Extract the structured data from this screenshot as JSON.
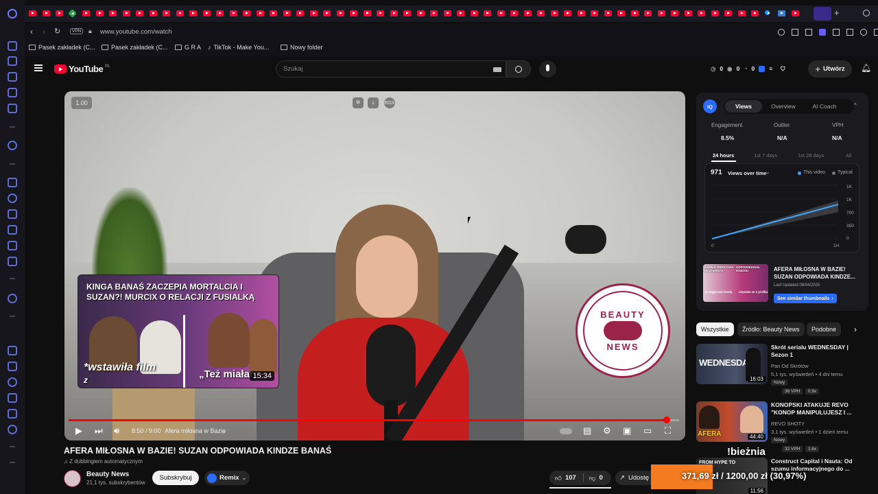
{
  "browser": {
    "url": "www.youtube.com/watch",
    "vpn_label": "VPN",
    "bookmarks": [
      "Pasek zakładek (C...",
      "Pasek zakładek (C...",
      "G R A",
      "TikTok - Make You...",
      "Nowy folder"
    ]
  },
  "header": {
    "logo": "YouTube",
    "logo_region": "PL",
    "search_placeholder": "Szukaj",
    "stats": [
      "0",
      "0",
      "0"
    ],
    "create_label": "Utwórz"
  },
  "player": {
    "speed": "1.00",
    "top_badge": "RGX",
    "current_time": "8:50 / 9:00",
    "chapter": "Afera miłosna w Bazie",
    "progress_fraction": 0.98,
    "logo_top": "BEAUTY",
    "logo_bottom": "NEWS",
    "preview": {
      "title": "KINGA BANAŚ ZACZEPIA MORTALCIA I SUZAN?! MURCIX O RELACJI Z FUSIALKĄ",
      "caption_left": "*wstawiła film",
      "caption_left_2": "z",
      "caption_right": "„Też miałar",
      "duration": "15:34"
    }
  },
  "video": {
    "title": "AFERA MIŁOSNA W BAZIE! SUZAN ODPOWIADA KINDZE BANAŚ",
    "dub_note": "Z dubbingiem automatycznym",
    "channel_name": "Beauty News",
    "channel_subs": "21,1 tys. subskrybentów",
    "subscribe_label": "Subskrybuj",
    "remix_label": "Remix",
    "likes": "107",
    "dislikes": "0",
    "share_label": "Udostę"
  },
  "iq_panel": {
    "logo": "IQ",
    "tabs": [
      "Views",
      "Overview",
      "AI Coach"
    ],
    "metrics": [
      {
        "label": "Engagement",
        "value": "8.5%"
      },
      {
        "label": "Outlier",
        "value": "N/A"
      },
      {
        "label": "VPH",
        "value": "N/A"
      }
    ],
    "periods": [
      "24 hours",
      "1st 7 days",
      "1st 28 days",
      "All"
    ],
    "chart": {
      "total": "971",
      "title": "Views over time",
      "legend_this": "This video",
      "legend_typical": "Typical",
      "y_ticks": [
        "1K",
        "1K",
        "700",
        "350",
        "0"
      ],
      "x_start": "0",
      "x_end": "1H"
    },
    "related": {
      "title": "AFERA MIŁOSNA W BAZIE! SUZAN ODPOWIADA KINDZE...",
      "updated": "Last Updated 08/04/2025",
      "button": "See similar thumbnails",
      "thumb_text_1": "ZAWIŁE PIERCOWA ROZTERKI?!",
      "thumb_text_2": "ODPOWIEDZIAŁ KINDZE!",
      "thumb_text_3": "w najgorsze brudy",
      "thumb_text_4": "używało ze z profilu"
    }
  },
  "chips": [
    "Wszystkie",
    "Źródło: Beauty News",
    "Podobne"
  ],
  "recommendations": [
    {
      "title": "Skrót serialu WEDNESDAY | Sezon 1",
      "channel": "Pan Od Skrótów",
      "meta": "5,1 tys. wyświetleń • 4 dni temu",
      "badge": "Nowy",
      "vph": "36 VPH",
      "ratio": "0.9x",
      "duration": "16:03",
      "thumb_text": "WEDNESDAY"
    },
    {
      "title": "KONOPSKI ATAKUJE REVO \"KONOP MANIPULUJESZ I ...",
      "channel": "REVO SHOTY",
      "meta": "3,1 tys. wyświetleń • 1 dzień temu",
      "badge": "Nowy",
      "vph": "32 VPH",
      "ratio": "1.6x",
      "duration": "44:40",
      "thumb_text": "AFERA"
    },
    {
      "title": "Construct Capital i Nauta: Od szumu informacyjnego do ...",
      "channel": "",
      "meta": "",
      "badge": "",
      "vph": "",
      "ratio": "",
      "duration": "11:56",
      "thumb_text": "FROM HYPE TO"
    }
  ],
  "ticker": {
    "label": "!bieżnia",
    "text": "371,69 zł / 1200,00 zł (30,97%)"
  },
  "colors": {
    "youtube_red": "#ff0033",
    "brand_beauty_news": "#9b2248",
    "iq_blue": "#2b6cff",
    "ticker_orange": "#f47b20"
  }
}
